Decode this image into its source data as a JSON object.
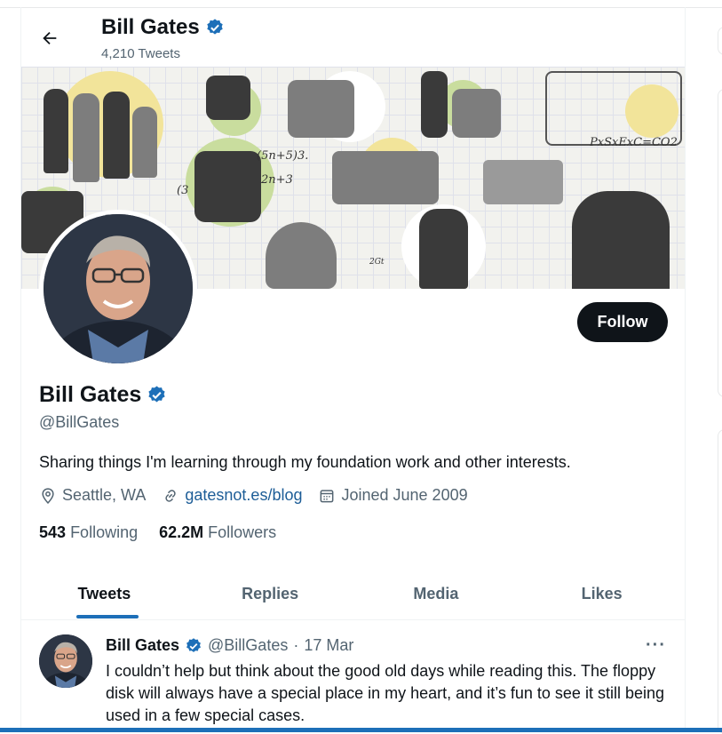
{
  "header": {
    "name": "Bill Gates",
    "tweet_count": "4,210 Tweets"
  },
  "banner": {
    "sketch_text_1": "(5n+5)3.",
    "sketch_text_2": "2n+3",
    "sketch_text_3": "(3",
    "sketch_text_4": "PxSxExC=CO2",
    "sketch_text_5": "2Gt"
  },
  "profile": {
    "name": "Bill Gates",
    "handle": "@BillGates",
    "bio": "Sharing things I'm learning through my foundation work and other interests.",
    "location": "Seattle, WA",
    "link": "gatesnot.es/blog",
    "joined": "Joined June 2009",
    "following_count": "543",
    "following_label": "Following",
    "followers_count": "62.2M",
    "followers_label": "Followers",
    "follow_button": "Follow"
  },
  "tabs": [
    "Tweets",
    "Replies",
    "Media",
    "Likes"
  ],
  "active_tab": "Tweets",
  "tweet": {
    "name": "Bill Gates",
    "handle": "@BillGates",
    "separator": "·",
    "date": "17 Mar",
    "more": "···",
    "text": "I couldn’t help but think about the good old days while reading this. The floppy disk will always have a special place in my heart, and it’s fun to see it still being used in a few special cases."
  },
  "colors": {
    "verified": "#1d6fb8",
    "link": "#1d5d97",
    "follow_bg": "#0f1419",
    "tab_indicator": "#1d6fb8"
  },
  "icons": {
    "back": "arrow-left-icon",
    "verified": "verified-badge-icon",
    "location": "location-pin-icon",
    "link": "link-icon",
    "calendar": "calendar-icon",
    "more": "more-icon"
  }
}
